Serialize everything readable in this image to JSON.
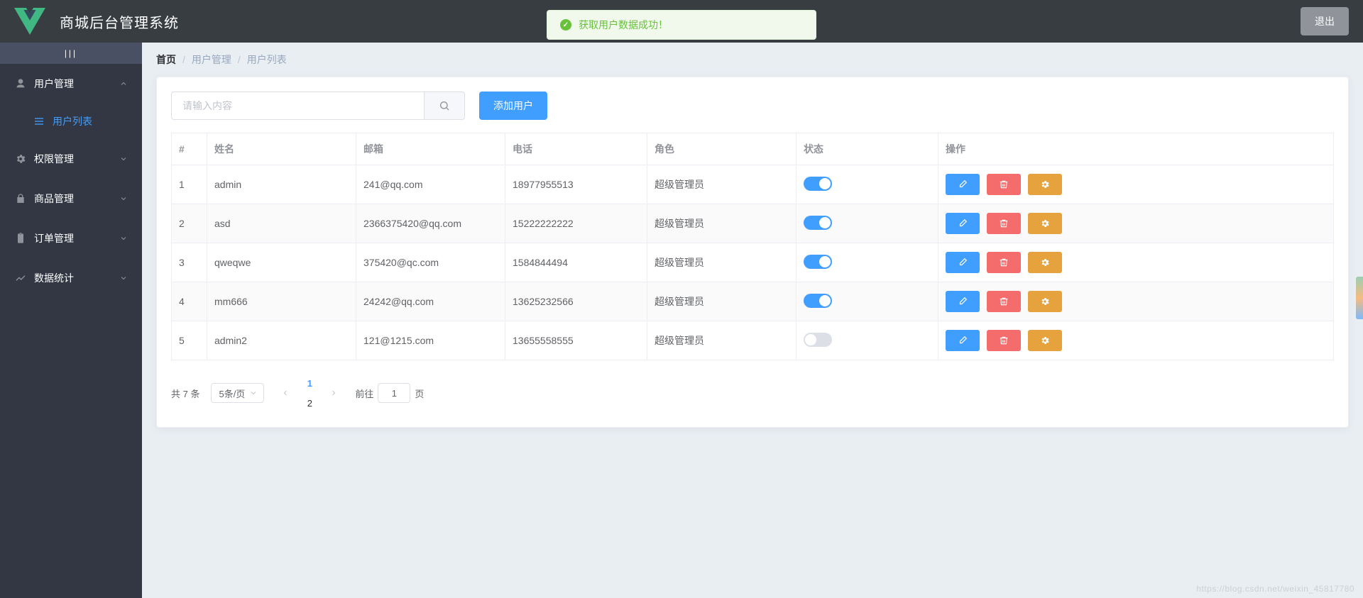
{
  "header": {
    "title": "商城后台管理系统",
    "logout": "退出"
  },
  "toast": {
    "message": "获取用户数据成功！"
  },
  "sidebar": {
    "collapse_glyph": "|||",
    "items": [
      {
        "icon": "user-icon",
        "label": "用户管理",
        "open": true,
        "sub": [
          {
            "label": "用户列表",
            "active": true
          }
        ]
      },
      {
        "icon": "gear-icon",
        "label": "权限管理"
      },
      {
        "icon": "lock-icon",
        "label": "商品管理"
      },
      {
        "icon": "clipboard-icon",
        "label": "订单管理"
      },
      {
        "icon": "chart-icon",
        "label": "数据统计"
      }
    ]
  },
  "breadcrumb": {
    "home": "首页",
    "group": "用户管理",
    "page": "用户列表"
  },
  "toolbar": {
    "search_placeholder": "请输入内容",
    "add_user": "添加用户"
  },
  "table": {
    "cols": {
      "idx": "#",
      "name": "姓名",
      "email": "邮箱",
      "phone": "电话",
      "role": "角色",
      "state": "状态",
      "ops": "操作"
    },
    "rows": [
      {
        "idx": "1",
        "name": "admin",
        "email": "241@qq.com",
        "phone": "18977955513",
        "role": "超级管理员",
        "state": true
      },
      {
        "idx": "2",
        "name": "asd",
        "email": "2366375420@qq.com",
        "phone": "15222222222",
        "role": "超级管理员",
        "state": true
      },
      {
        "idx": "3",
        "name": "qweqwe",
        "email": "375420@qc.com",
        "phone": "1584844494",
        "role": "超级管理员",
        "state": true
      },
      {
        "idx": "4",
        "name": "mm666",
        "email": "24242@qq.com",
        "phone": "13625232566",
        "role": "超级管理员",
        "state": true
      },
      {
        "idx": "5",
        "name": "admin2",
        "email": "121@1215.com",
        "phone": "13655558555",
        "role": "超级管理员",
        "state": false
      }
    ]
  },
  "pagination": {
    "total_text": "共 7 条",
    "page_size": "5条/页",
    "pages": [
      "1",
      "2"
    ],
    "current": "1",
    "goto_prefix": "前往",
    "goto_value": "1",
    "goto_suffix": "页"
  },
  "watermark": "https://blog.csdn.net/weixin_45817780"
}
